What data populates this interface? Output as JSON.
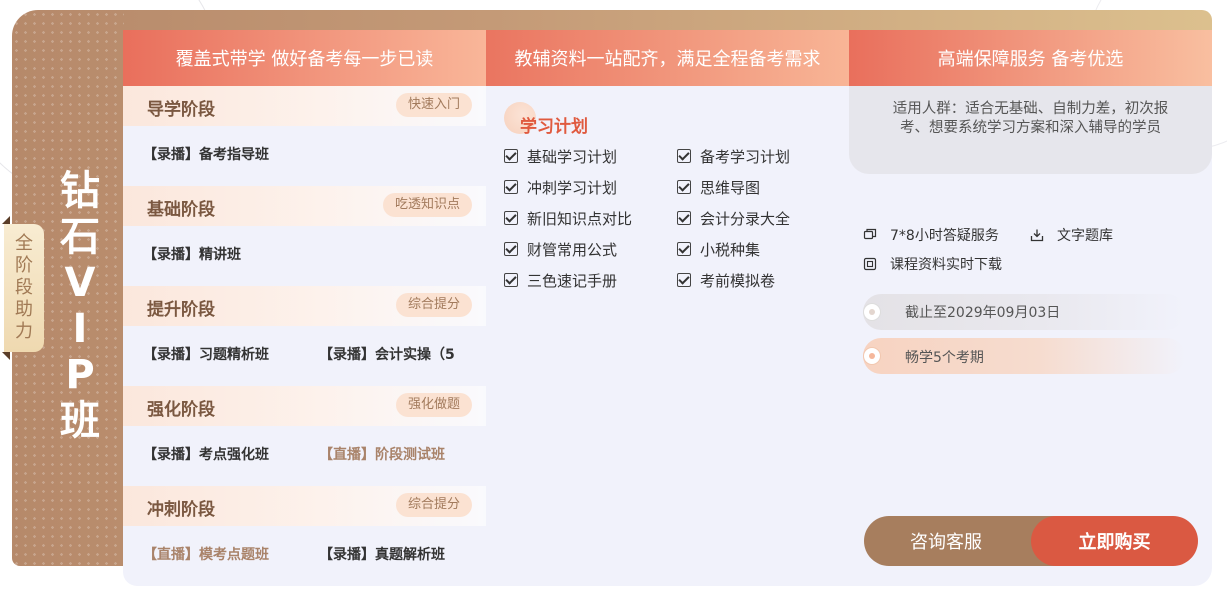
{
  "card": {
    "title_chars": [
      "钻",
      "石",
      "V",
      "I",
      "P",
      "班"
    ],
    "side_tab_chars": [
      "全",
      "阶",
      "段",
      "助",
      "力"
    ]
  },
  "headers": [
    "覆盖式带学 做好备考每一步已读",
    "教辅资料一站配齐，满足全程备考需求",
    "高端保障服务 备考优选"
  ],
  "stages": [
    {
      "name": "导学阶段",
      "tag": "快速入门",
      "courses": [
        {
          "text": "【录播】备考指导班",
          "live": false
        }
      ]
    },
    {
      "name": "基础阶段",
      "tag": "吃透知识点",
      "courses": [
        {
          "text": "【录播】精讲班",
          "live": false
        }
      ]
    },
    {
      "name": "提升阶段",
      "tag": "综合提分",
      "courses": [
        {
          "text": "【录播】习题精析班",
          "live": false
        },
        {
          "text": "【录播】会计实操（5",
          "live": false
        }
      ]
    },
    {
      "name": "强化阶段",
      "tag": "强化做题",
      "courses": [
        {
          "text": "【录播】考点强化班",
          "live": false
        },
        {
          "text": "【直播】阶段测试班",
          "live": true
        }
      ]
    },
    {
      "name": "冲刺阶段",
      "tag": "综合提分",
      "courses": [
        {
          "text": "【直播】模考点题班",
          "live": true
        },
        {
          "text": "【录播】真题解析班",
          "live": false
        }
      ]
    }
  ],
  "plan": {
    "title": "学习计划",
    "items": [
      "基础学习计划",
      "备考学习计划",
      "冲刺学习计划",
      "思维导图",
      "新旧知识点对比",
      "会计分录大全",
      "财管常用公式",
      "小税种集",
      "三色速记手册",
      "考前模拟卷"
    ]
  },
  "service": {
    "audience": "适用人群：适合无基础、自制力差，初次报考、想要系统学习方案和深入辅导的学员",
    "items": [
      "7*8小时答疑服务",
      "文字题库",
      "课程资料实时下载"
    ],
    "deadline": "截止至2029年09月03日",
    "periods": "畅学5个考期"
  },
  "buttons": {
    "consult": "咨询客服",
    "buy": "立即购买"
  },
  "colors": {
    "accent": "#da5942",
    "brown": "#a77e5e"
  }
}
